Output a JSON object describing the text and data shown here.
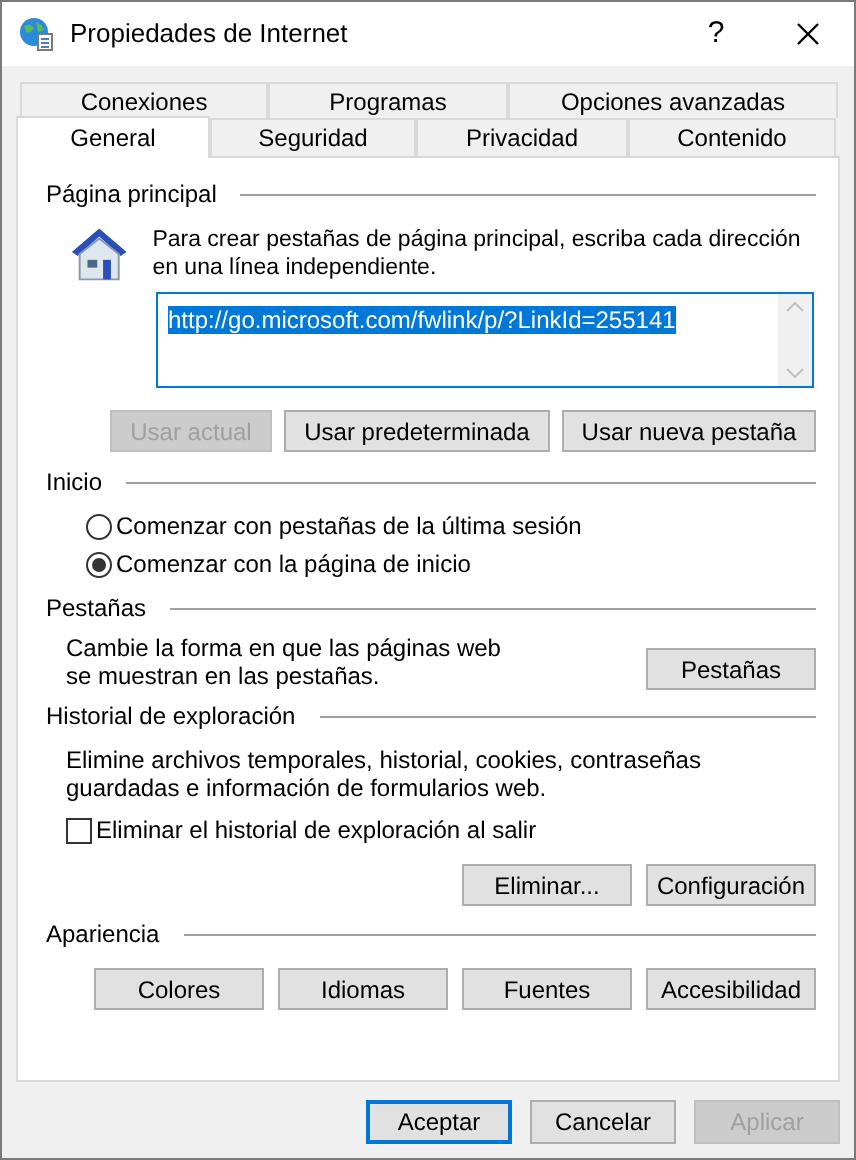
{
  "window": {
    "title": "Propiedades de Internet",
    "help": "?"
  },
  "tab_rows": [
    [
      {
        "label": "Conexiones",
        "selected": false
      },
      {
        "label": "Programas",
        "selected": false
      },
      {
        "label": "Opciones avanzadas",
        "selected": false
      }
    ],
    [
      {
        "label": "General",
        "selected": true
      },
      {
        "label": "Seguridad",
        "selected": false
      },
      {
        "label": "Privacidad",
        "selected": false
      },
      {
        "label": "Contenido",
        "selected": false
      }
    ]
  ],
  "home_page": {
    "heading": "Página principal",
    "description": "Para crear pestañas de página principal, escriba cada dirección en una línea independiente.",
    "url": "http://go.microsoft.com/fwlink/p/?LinkId=255141",
    "url_selected": true,
    "buttons": [
      {
        "label": "Usar actual",
        "disabled": true
      },
      {
        "label": "Usar predeterminada",
        "disabled": false
      },
      {
        "label": "Usar nueva pestaña",
        "disabled": false
      }
    ]
  },
  "startup": {
    "heading": "Inicio",
    "options": [
      {
        "label": "Comenzar con pestañas de la última sesión",
        "selected": false
      },
      {
        "label": "Comenzar con la página de inicio",
        "selected": true
      }
    ]
  },
  "tabs_section": {
    "heading": "Pestañas",
    "description": "Cambie la forma en que las páginas web se muestran en las pestañas.",
    "button": "Pestañas"
  },
  "history": {
    "heading": "Historial de exploración",
    "description": "Elimine archivos temporales, historial, cookies, contraseñas guardadas e información de formularios web.",
    "checkbox": {
      "label": "Eliminar el historial de exploración al salir",
      "checked": false
    },
    "buttons": [
      {
        "label": "Eliminar...",
        "disabled": false
      },
      {
        "label": "Configuración",
        "disabled": false
      }
    ]
  },
  "appearance": {
    "heading": "Apariencia",
    "buttons": [
      {
        "label": "Colores",
        "disabled": false
      },
      {
        "label": "Idiomas",
        "disabled": false
      },
      {
        "label": "Fuentes",
        "disabled": false
      },
      {
        "label": "Accesibilidad",
        "disabled": false
      }
    ]
  },
  "footer": [
    {
      "label": "Aceptar",
      "default": true,
      "disabled": false
    },
    {
      "label": "Cancelar",
      "default": false,
      "disabled": false
    },
    {
      "label": "Aplicar",
      "default": false,
      "disabled": true
    }
  ]
}
